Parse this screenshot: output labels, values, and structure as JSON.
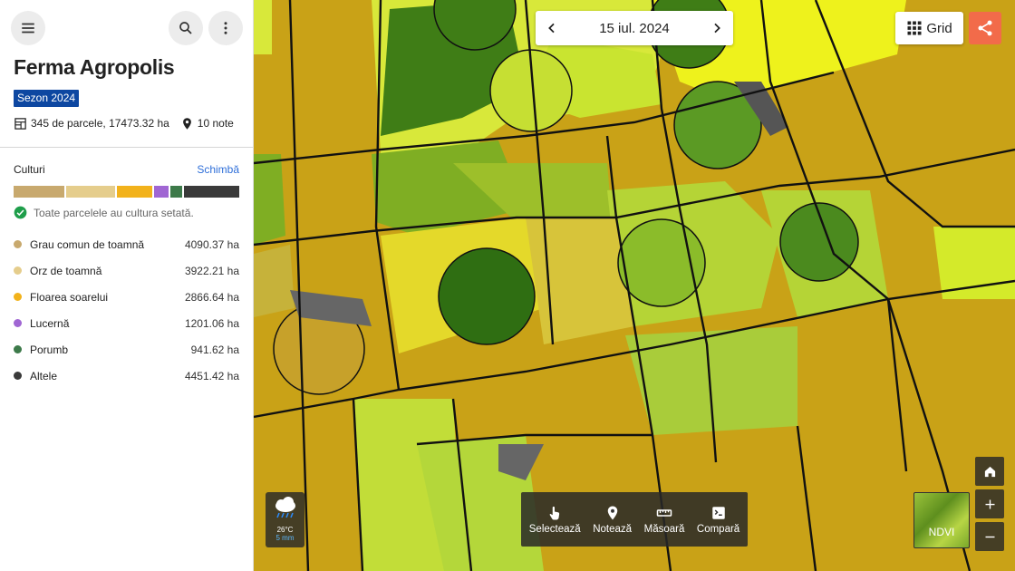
{
  "sidebar": {
    "farm_title": "Ferma Agropolis",
    "season_badge": "Sezon 2024",
    "parcels_stats": "345 de parcele, 17473.32 ha",
    "notes_count": "10 note",
    "crops_title": "Culturi",
    "change_link": "Schimbă",
    "all_set_message": "Toate parcelele au cultura setată.",
    "crops": [
      {
        "name": "Grau comun de toamnă",
        "area": "4090.37 ha",
        "color": "#c8a96e"
      },
      {
        "name": "Orz de toamnă",
        "area": "3922.21 ha",
        "color": "#e5cd8c"
      },
      {
        "name": "Floarea soarelui",
        "area": "2866.64 ha",
        "color": "#f2b21b"
      },
      {
        "name": "Lucernă",
        "area": "1201.06 ha",
        "color": "#a066d3"
      },
      {
        "name": "Porumb",
        "area": "941.62 ha",
        "color": "#3d7a4a"
      },
      {
        "name": "Altele",
        "area": "4451.42 ha",
        "color": "#3a3a3a"
      }
    ]
  },
  "map": {
    "date": "15 iul. 2024",
    "grid_label": "Grid",
    "share_color": "#f26b4a",
    "weather": {
      "temperature": "26°C",
      "precipitation": "5 mm",
      "icon": "rain-cloud-icon"
    },
    "tools": [
      {
        "label": "Selectează",
        "icon": "hand-pointer-icon"
      },
      {
        "label": "Notează",
        "icon": "map-pin-icon"
      },
      {
        "label": "Măsoară",
        "icon": "ruler-icon"
      },
      {
        "label": "Compară",
        "icon": "compare-icon"
      }
    ],
    "layer_label": "NDVI"
  }
}
